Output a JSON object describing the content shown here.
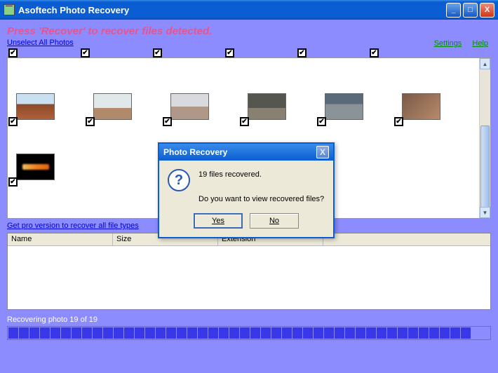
{
  "window": {
    "title": "Asoftech Photo Recovery",
    "min": "_",
    "max": "□",
    "close": "X"
  },
  "instruction": "Press 'Recover' to recover files detected.",
  "unselect_link": "Unselect All Photos",
  "settings_link": "Settings",
  "help_link": "Help",
  "pro_link": "Get pro version to recover all file types",
  "table": {
    "col_name": "Name",
    "col_size": "Size",
    "col_ext": "Extension"
  },
  "status": "Recovering photo 19 of 19",
  "dialog": {
    "title": "Photo Recovery",
    "close": "X",
    "icon": "?",
    "line1": "19 files recovered.",
    "line2": "Do you want to view recovered files?",
    "yes": "Yes",
    "no": "No"
  },
  "check": "✔",
  "progress_segments": 44
}
